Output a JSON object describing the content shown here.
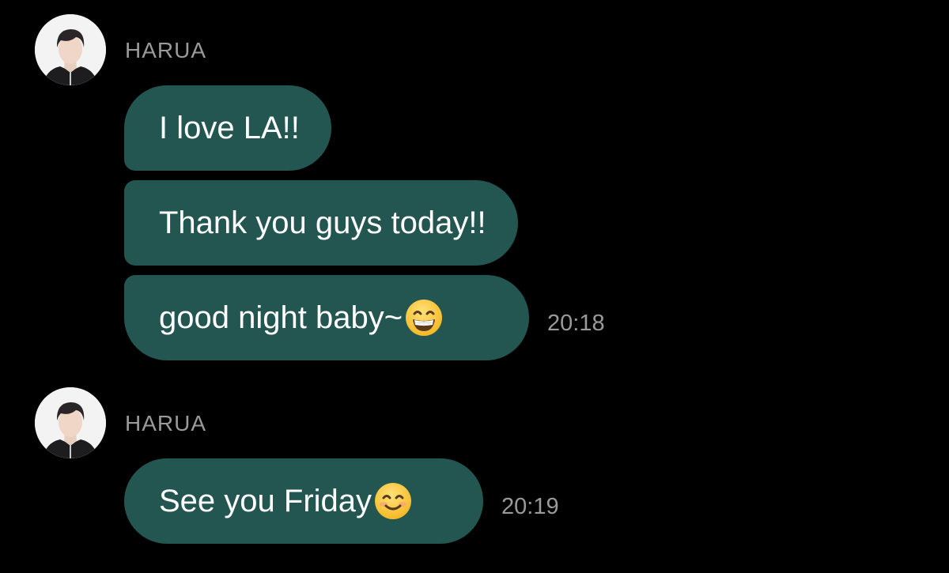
{
  "groups": [
    {
      "sender": "HARUA",
      "messages": [
        {
          "text": "I love LA!!",
          "emoji": null
        },
        {
          "text": "Thank you guys today!!",
          "emoji": null
        },
        {
          "text": "good night baby~",
          "emoji": "grinning-face-emoji"
        }
      ],
      "time": "20:18"
    },
    {
      "sender": "HARUA",
      "messages": [
        {
          "text": "See you Friday",
          "emoji": "smiling-face-emoji"
        }
      ],
      "time": "20:19"
    }
  ],
  "colors": {
    "background": "#000000",
    "bubble": "#235650",
    "bubble_text": "#ffffff",
    "meta_text": "#9a9a9a"
  }
}
